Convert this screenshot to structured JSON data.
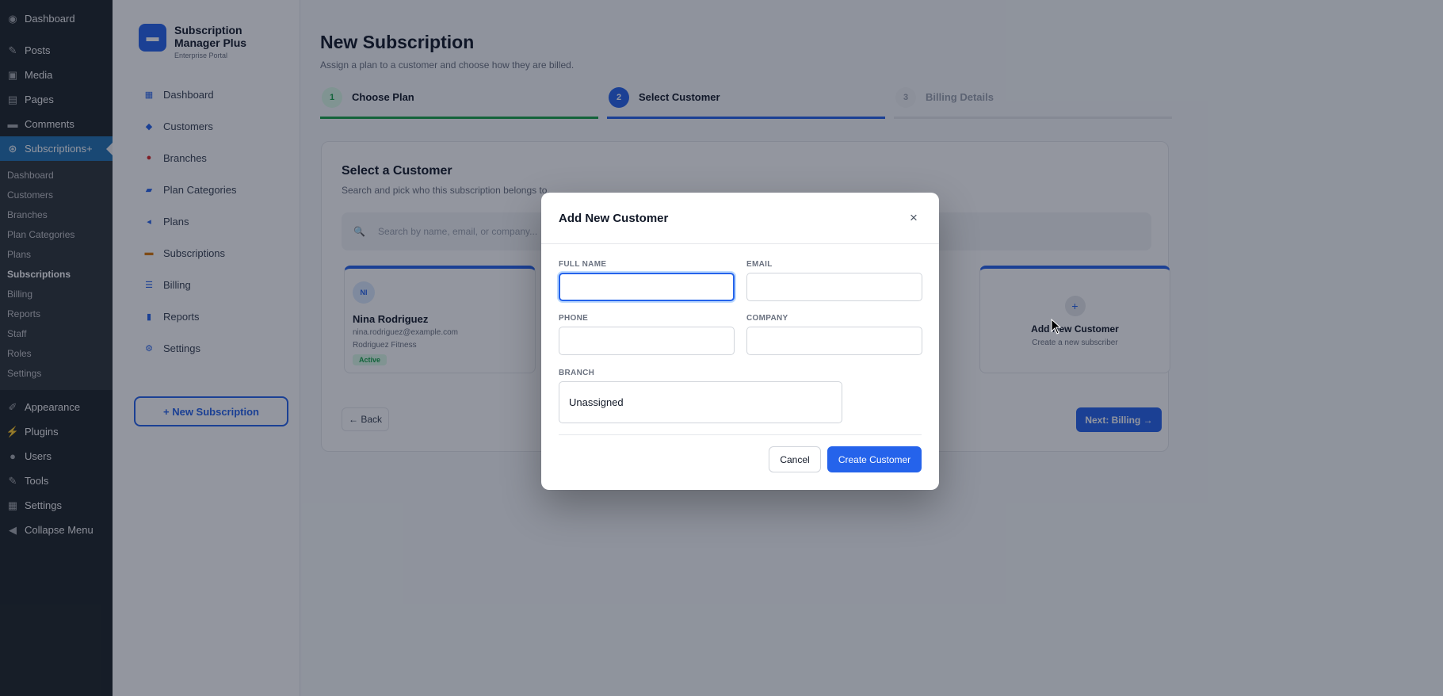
{
  "wp_menu": {
    "items_top": [
      {
        "label": "Dashboard",
        "icon": "dashboard-icon"
      },
      {
        "label": "Posts",
        "icon": "pin-icon"
      },
      {
        "label": "Media",
        "icon": "media-icon"
      },
      {
        "label": "Pages",
        "icon": "page-icon"
      },
      {
        "label": "Comments",
        "icon": "comment-icon"
      }
    ],
    "active_item": {
      "label": "Subscriptions+",
      "icon": "subscription-icon"
    },
    "submenu": [
      "Dashboard",
      "Customers",
      "Branches",
      "Plan Categories",
      "Plans",
      "Subscriptions",
      "Billing",
      "Reports",
      "Staff",
      "Roles",
      "Settings"
    ],
    "submenu_current": "Subscriptions",
    "items_bottom": [
      {
        "label": "Appearance",
        "icon": "brush-icon"
      },
      {
        "label": "Plugins",
        "icon": "plugin-icon"
      },
      {
        "label": "Users",
        "icon": "user-icon"
      },
      {
        "label": "Tools",
        "icon": "wrench-icon"
      },
      {
        "label": "Settings",
        "icon": "settings-icon"
      },
      {
        "label": "Collapse Menu",
        "icon": "collapse-icon"
      }
    ]
  },
  "plugin": {
    "brand_title": "Subscription Manager Plus",
    "brand_subtitle": "Enterprise Portal",
    "nav": [
      {
        "label": "Dashboard",
        "icon": "grid-icon"
      },
      {
        "label": "Customers",
        "icon": "users-icon"
      },
      {
        "label": "Branches",
        "icon": "location-pin-icon"
      },
      {
        "label": "Plan Categories",
        "icon": "folder-icon"
      },
      {
        "label": "Plans",
        "icon": "tag-icon"
      },
      {
        "label": "Subscriptions",
        "icon": "card-icon"
      },
      {
        "label": "Billing",
        "icon": "list-icon"
      },
      {
        "label": "Reports",
        "icon": "bar-chart-icon"
      },
      {
        "label": "Settings",
        "icon": "gear-icon"
      }
    ],
    "new_subscription_label": "+ New Subscription"
  },
  "main": {
    "title": "New Subscription",
    "subtitle": "Assign a plan to a customer and choose how they are billed.",
    "steps": [
      {
        "num": "1",
        "label": "Choose Plan",
        "state": "done"
      },
      {
        "num": "2",
        "label": "Select Customer",
        "state": "current"
      },
      {
        "num": "3",
        "label": "Billing Details",
        "state": "todo"
      }
    ],
    "section_title": "Select a Customer",
    "section_subtitle": "Search and pick who this subscription belongs to.",
    "search_placeholder": "Search by name, email, or company...",
    "customer": {
      "initials": "NI",
      "name": "Nina Rodriguez",
      "email": "nina.rodriguez@example.com",
      "company": "Rodriguez Fitness",
      "status": "Active"
    },
    "add_card": {
      "icon": "+",
      "title": "Add New Customer",
      "subtitle": "Create a new subscriber"
    },
    "back_label": "← Back",
    "next_label": "Next: Billing →"
  },
  "modal": {
    "title": "Add New Customer",
    "close_glyph": "×",
    "fields": {
      "full_name": {
        "label": "FULL NAME",
        "value": ""
      },
      "email": {
        "label": "EMAIL",
        "value": ""
      },
      "phone": {
        "label": "PHONE",
        "value": ""
      },
      "company": {
        "label": "COMPANY",
        "value": ""
      },
      "branch": {
        "label": "BRANCH",
        "value": "Unassigned"
      }
    },
    "cancel_label": "Cancel",
    "create_label": "Create Customer"
  },
  "colors": {
    "accent": "#2563eb",
    "success": "#16a34a",
    "wp_sidebar": "#1d2327",
    "wp_active": "#2271b1"
  }
}
